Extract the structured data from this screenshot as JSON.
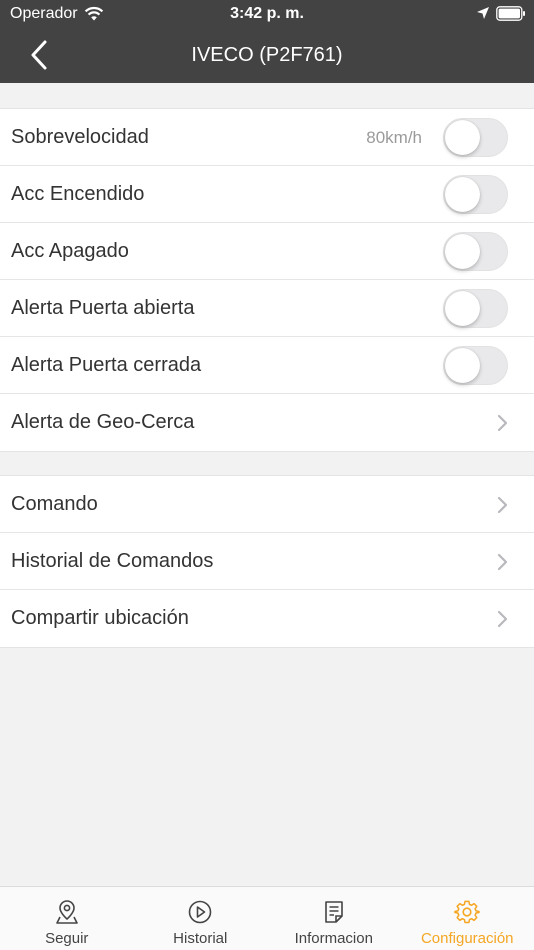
{
  "status": {
    "carrier": "Operador",
    "time": "3:42 p. m."
  },
  "header": {
    "title": "IVECO (P2F761)"
  },
  "group1": [
    {
      "label": "Sobrevelocidad",
      "value": "80km/h",
      "control": "toggle",
      "on": false
    },
    {
      "label": "Acc Encendido",
      "control": "toggle",
      "on": false
    },
    {
      "label": "Acc Apagado",
      "control": "toggle",
      "on": false
    },
    {
      "label": "Alerta Puerta abierta",
      "control": "toggle",
      "on": false
    },
    {
      "label": "Alerta Puerta cerrada",
      "control": "toggle",
      "on": false
    },
    {
      "label": "Alerta de Geo-Cerca",
      "control": "chevron"
    }
  ],
  "group2": [
    {
      "label": "Comando",
      "control": "chevron"
    },
    {
      "label": "Historial de Comandos",
      "control": "chevron"
    },
    {
      "label": "Compartir ubicación",
      "control": "chevron"
    }
  ],
  "tabs": [
    {
      "label": "Seguir",
      "icon": "map-pin-icon"
    },
    {
      "label": "Historial",
      "icon": "play-circle-icon"
    },
    {
      "label": "Informacion",
      "icon": "document-icon"
    },
    {
      "label": "Configuración",
      "icon": "gear-icon",
      "active": true
    }
  ],
  "colors": {
    "bar": "#434343",
    "accent": "#f5a623"
  }
}
